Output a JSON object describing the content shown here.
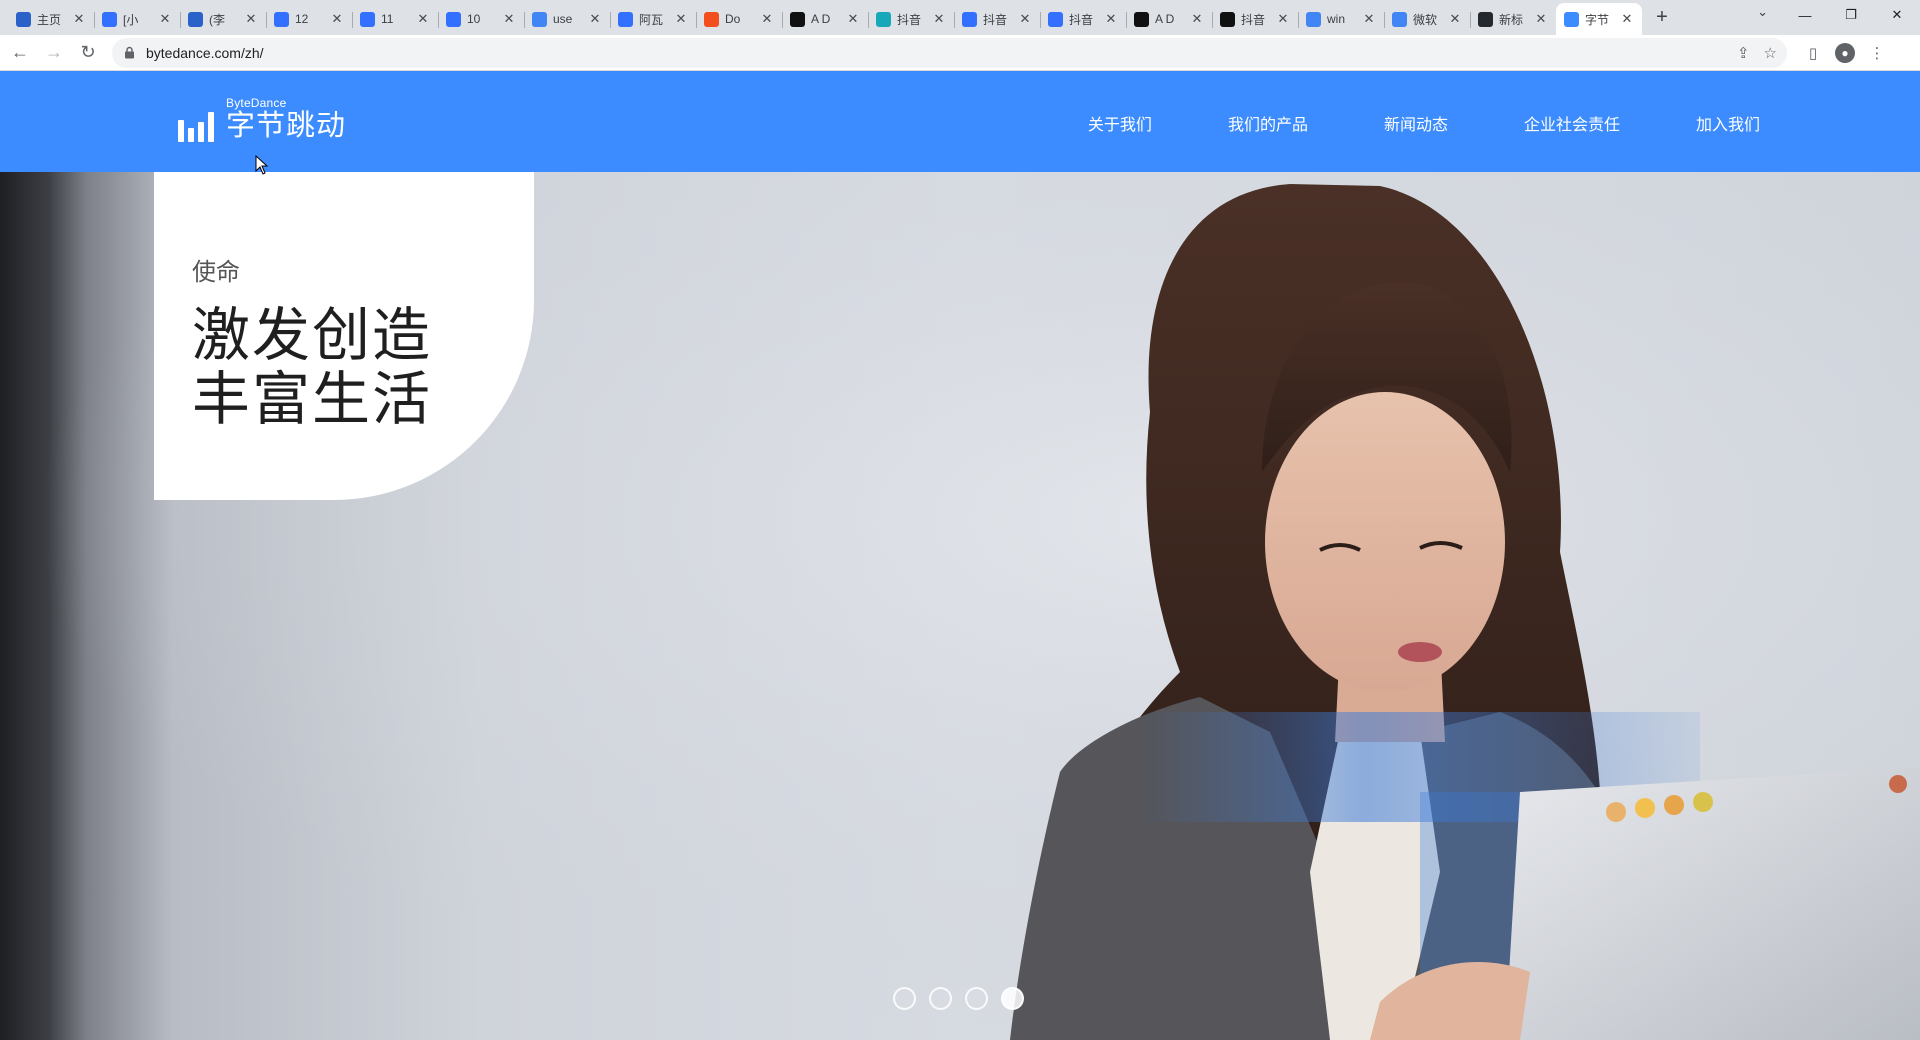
{
  "browser": {
    "tabs": [
      {
        "title": "主页",
        "favicon": "blue-bird-icon",
        "color": "#2a62c9"
      },
      {
        "title": "[小",
        "favicon": "doc-icon",
        "color": "#3370ff"
      },
      {
        "title": "(李",
        "favicon": "blue-bird-icon",
        "color": "#2a62c9"
      },
      {
        "title": "12",
        "favicon": "doc-icon",
        "color": "#3370ff"
      },
      {
        "title": "11",
        "favicon": "doc-icon",
        "color": "#3370ff"
      },
      {
        "title": "10",
        "favicon": "doc-icon",
        "color": "#3370ff"
      },
      {
        "title": "use",
        "favicon": "google-icon",
        "color": "#4285f4"
      },
      {
        "title": "阿瓦",
        "favicon": "doc-icon",
        "color": "#3370ff"
      },
      {
        "title": "Do",
        "favicon": "figma-icon",
        "color": "#f24e1e"
      },
      {
        "title": "A D",
        "favicon": "a-icon",
        "color": "#111111"
      },
      {
        "title": "抖音",
        "favicon": "app-icon",
        "color": "#19a8b8"
      },
      {
        "title": "抖音",
        "favicon": "doc-icon",
        "color": "#3370ff"
      },
      {
        "title": "抖音",
        "favicon": "doc-icon",
        "color": "#3370ff"
      },
      {
        "title": "A D",
        "favicon": "a-icon",
        "color": "#111111"
      },
      {
        "title": "抖音",
        "favicon": "tiktok-icon",
        "color": "#111111"
      },
      {
        "title": "win",
        "favicon": "google-icon",
        "color": "#4285f4"
      },
      {
        "title": "微软",
        "favicon": "google-icon",
        "color": "#4285f4"
      },
      {
        "title": "新标",
        "favicon": "github-icon",
        "color": "#24292f"
      },
      {
        "title": "字节",
        "favicon": "bytedance-icon",
        "color": "#3c8cff",
        "active": true
      }
    ],
    "url": "bytedance.com/zh/"
  },
  "site": {
    "logo_en": "ByteDance",
    "logo_cn": "字节跳动",
    "nav": [
      "关于我们",
      "我们的产品",
      "新闻动态",
      "企业社会责任",
      "加入我们"
    ]
  },
  "hero": {
    "label": "使命",
    "slogan_line1": "激发创造",
    "slogan_line2": "丰富生活",
    "slides_total": 4,
    "active_slide": 4
  },
  "colors": {
    "brand_blue": "#3c8cff",
    "tab_strip": "#dee1e6"
  }
}
